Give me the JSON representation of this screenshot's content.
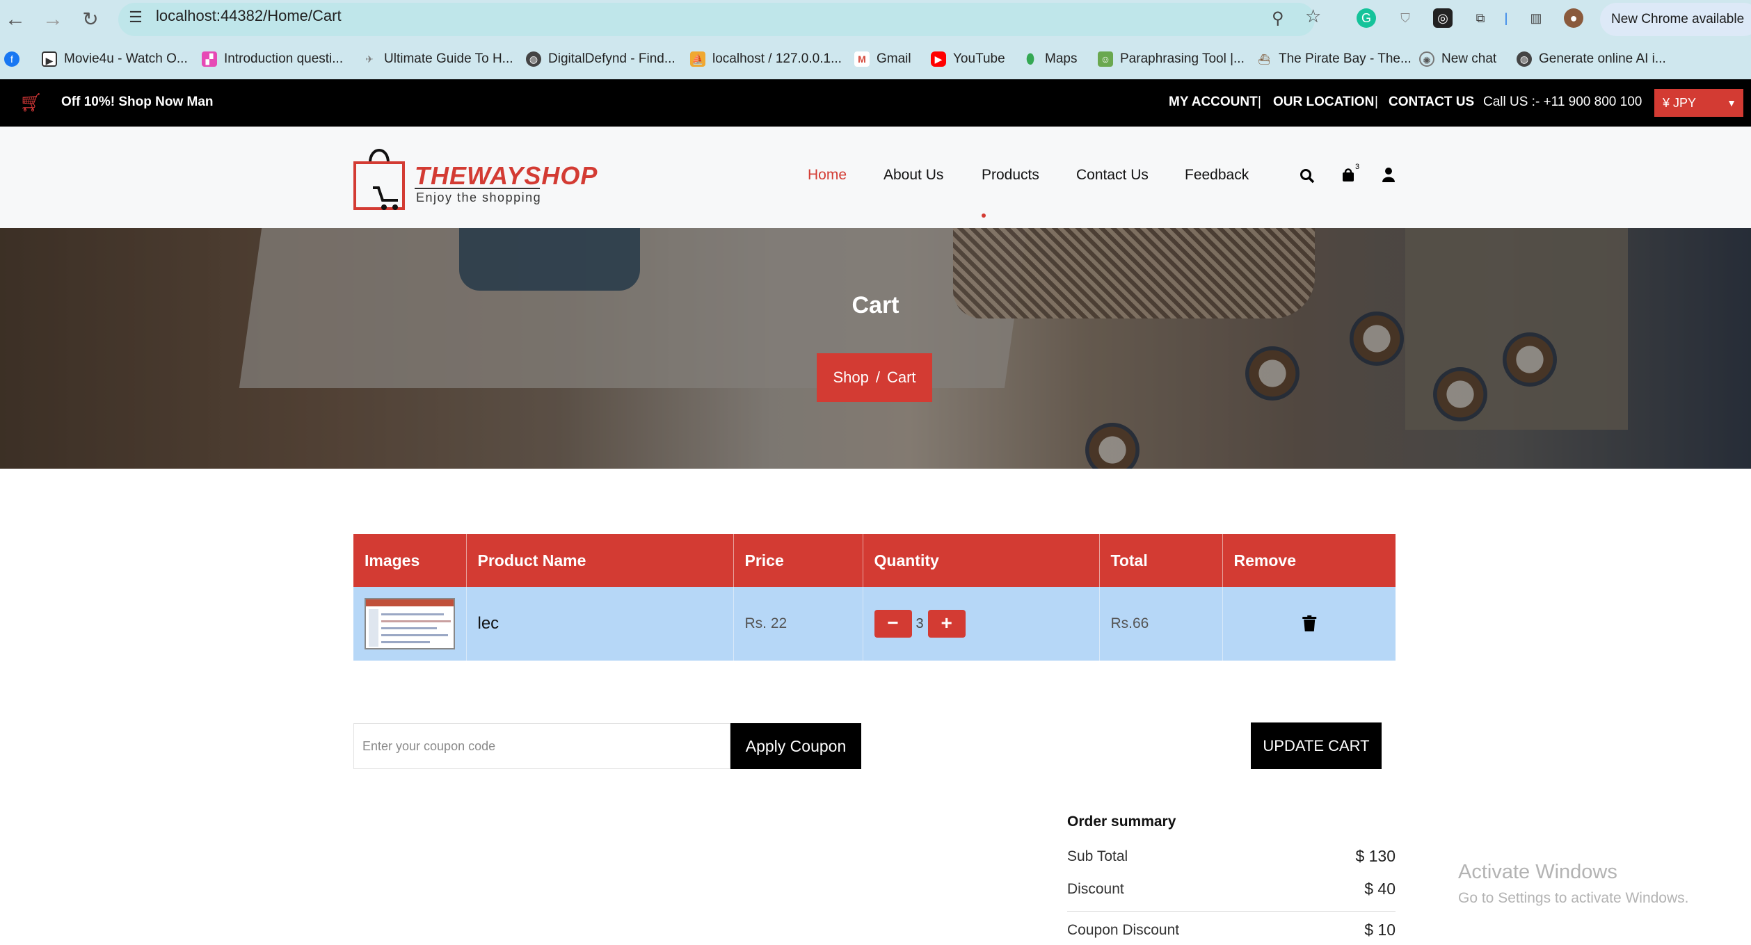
{
  "browser": {
    "url": "localhost:44382/Home/Cart",
    "new_chrome": "New Chrome available",
    "bookmarks": [
      "Movie4u - Watch O...",
      "Introduction questi...",
      "Ultimate Guide To H...",
      "DigitalDefynd - Find...",
      "localhost / 127.0.0.1...",
      "Gmail",
      "YouTube",
      "Maps",
      "Paraphrasing Tool |...",
      "The Pirate Bay - The...",
      "New chat",
      "Generate online AI i..."
    ]
  },
  "topbar": {
    "promo": "Off 10%! Shop Now Man",
    "my_account": "MY ACCOUNT",
    "our_location": "OUR LOCATION",
    "contact_us": "CONTACT US",
    "call": "Call US :- +11 900 800 100",
    "currency": "¥ JPY",
    "separator": "|"
  },
  "brand": {
    "title": "THEWAYSHOP",
    "tagline": "Enjoy the shopping",
    "accent": "#d33b33"
  },
  "nav": {
    "items": [
      "Home",
      "About Us",
      "Products",
      "Contact Us",
      "Feedback"
    ],
    "cart_count": "3"
  },
  "banner": {
    "title": "Cart",
    "breadcrumb": [
      "Shop",
      "Cart"
    ],
    "breadcrumb_sep": "/"
  },
  "cart": {
    "headers": [
      "Images",
      "Product Name",
      "Price",
      "Quantity",
      "Total",
      "Remove"
    ],
    "rows": [
      {
        "name": "lec",
        "price": "Rs. 22",
        "quantity": "3",
        "total": "Rs.66"
      }
    ],
    "qty_minus": "−",
    "qty_plus": "+"
  },
  "coupon": {
    "placeholder": "Enter your coupon code",
    "apply_label": "Apply Coupon",
    "update_label": "UPDATE CART"
  },
  "summary": {
    "title": "Order summary",
    "rows": [
      {
        "label": "Sub Total",
        "value": "$ 130"
      },
      {
        "label": "Discount",
        "value": "$ 40"
      },
      {
        "label": "Coupon Discount",
        "value": "$ 10"
      }
    ]
  },
  "watermark": {
    "title": "Activate Windows",
    "subtitle": "Go to Settings to activate Windows."
  }
}
